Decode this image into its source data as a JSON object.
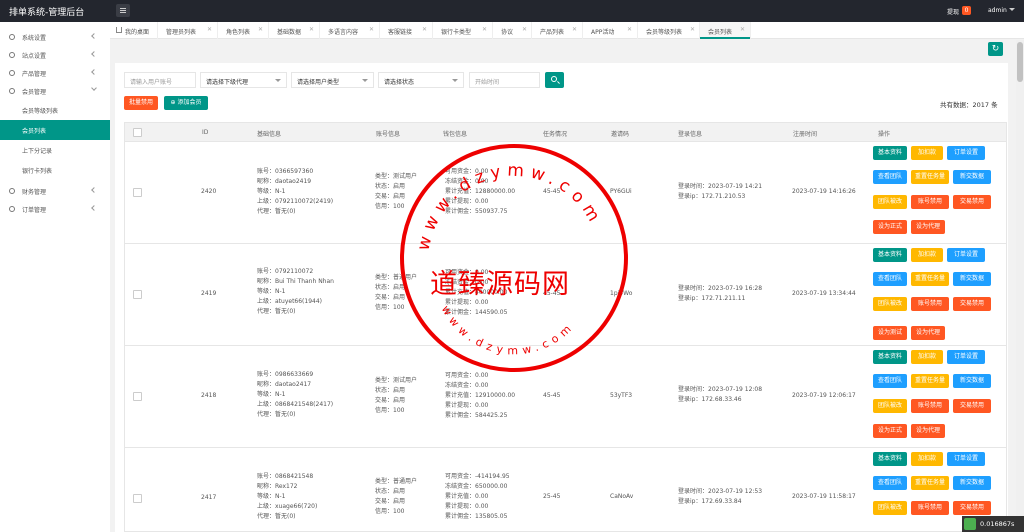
{
  "app": {
    "title": "排单系统-管理后台"
  },
  "header": {
    "notice_label": "提现",
    "notice_count": "0",
    "user": "admin"
  },
  "sidebar": {
    "items": [
      {
        "label": "系统设置"
      },
      {
        "label": "站点设置"
      },
      {
        "label": "产品管理"
      },
      {
        "label": "会员管理"
      },
      {
        "label": "财务管理"
      },
      {
        "label": "订单管理"
      }
    ],
    "member_sub": [
      {
        "label": "会员等级列表"
      },
      {
        "label": "会员列表"
      },
      {
        "label": "上下分记录"
      },
      {
        "label": "银行卡列表"
      }
    ]
  },
  "tabs": [
    {
      "label": "我的桌面"
    },
    {
      "label": "管理员列表"
    },
    {
      "label": "角色列表"
    },
    {
      "label": "基础数据"
    },
    {
      "label": "多语言内容"
    },
    {
      "label": "客服链接"
    },
    {
      "label": "银行卡类型"
    },
    {
      "label": "协议"
    },
    {
      "label": "产品列表"
    },
    {
      "label": "APP活动"
    },
    {
      "label": "会员等级列表"
    },
    {
      "label": "会员列表"
    }
  ],
  "filters": {
    "account_placeholder": "请输入用户账号",
    "agent": "请选择下级代理",
    "user_type": "请选择用户类型",
    "status": "请选择状态",
    "start_time": "开始时间"
  },
  "actions": {
    "batch_ban": "批量禁用",
    "add_member": "添加会员"
  },
  "total": "共有数据：2017 条",
  "columns": [
    "ID",
    "基础信息",
    "账号信息",
    "钱包信息",
    "任务情况",
    "邀请码",
    "登录信息",
    "注册时间",
    "操作"
  ],
  "rows": [
    {
      "id": "2420",
      "basic": [
        "账号：0366597360",
        "昵称：daotao2419",
        "等级：N-1",
        "上级：0792110072(2419)",
        "代理：暂无(0)"
      ],
      "account": [
        "类型：测试用户",
        "状态：启用",
        "交易：启用",
        "信用：100"
      ],
      "wallet": [
        "可用资金：0.00",
        "冻结资金：0.00",
        "累计充值：12880000.00",
        "累计提现：0.00",
        "累计佣金：550937.75"
      ],
      "task": "45-45",
      "invite": "PY6GUi",
      "login": [
        "登录时间：2023-07-19 14:21",
        "登录ip：172.71.210.53"
      ],
      "register": "2023-07-19 14:16:26",
      "ops": [
        [
          "基本资料",
          "加扣款",
          "订单设置"
        ],
        [
          "查看团队",
          "重置任务量",
          "新交数据"
        ],
        [
          "团队被改",
          "账号禁用",
          "交易禁用"
        ],
        [
          "设为正式",
          "设为代理"
        ]
      ]
    },
    {
      "id": "2419",
      "basic": [
        "账号：0792110072",
        "昵称：Bui Thi Thanh Nhan",
        "等级：N-1",
        "上级：atuyet66(1944)",
        "代理：暂无(0)"
      ],
      "account": [
        "类型：普通用户",
        "状态：启用",
        "交易：启用",
        "信用：100"
      ],
      "wallet": [
        "可用资金：0.00",
        "冻结资金：0.00",
        "累计充值：400000.00",
        "累计提现：0.00",
        "累计佣金：144590.05"
      ],
      "task": "45-45",
      "invite": "1pi4Wo",
      "login": [
        "登录时间：2023-07-19 16:28",
        "登录ip：172.71.211.11"
      ],
      "register": "2023-07-19 13:34:44",
      "ops": [
        [
          "基本资料",
          "加扣款",
          "订单设置"
        ],
        [
          "查看团队",
          "重置任务量",
          "新交数据"
        ],
        [
          "团队被改",
          "账号禁用",
          "交易禁用"
        ],
        [
          "设为测试",
          "设为代理"
        ]
      ]
    },
    {
      "id": "2418",
      "basic": [
        "账号：0986633669",
        "昵称：daotao2417",
        "等级：N-1",
        "上级：0868421548(2417)",
        "代理：暂无(0)"
      ],
      "account": [
        "类型：测试用户",
        "状态：启用",
        "交易：启用",
        "信用：100"
      ],
      "wallet": [
        "可用资金：0.00",
        "冻结资金：0.00",
        "累计充值：12910000.00",
        "累计提现：0.00",
        "累计佣金：584425.25"
      ],
      "task": "45-45",
      "invite": "53yTF3",
      "login": [
        "登录时间：2023-07-19 12:08",
        "登录ip：172.68.33.46"
      ],
      "register": "2023-07-19 12:06:17",
      "ops": [
        [
          "基本资料",
          "加扣款",
          "订单设置"
        ],
        [
          "查看团队",
          "重置任务量",
          "新交数据"
        ],
        [
          "团队被改",
          "账号禁用",
          "交易禁用"
        ],
        [
          "设为正式",
          "设为代理"
        ]
      ]
    },
    {
      "id": "2417",
      "basic": [
        "账号：0868421548",
        "昵称：Rex172",
        "等级：N-1",
        "上级：xuage66(720)",
        "代理：暂无(0)"
      ],
      "account": [
        "类型：普通用户",
        "状态：启用",
        "交易：启用",
        "信用：100"
      ],
      "wallet": [
        "可用资金：-414194.95",
        "冻结资金：650000.00",
        "累计充值：0.00",
        "累计提现：0.00",
        "累计佣金：135805.05"
      ],
      "task": "25-45",
      "invite": "CaNoAv",
      "login": [
        "登录时间：2023-07-19 12:53",
        "登录ip：172.69.33.84"
      ],
      "register": "2023-07-19 11:58:17",
      "ops": [
        [
          "基本资料",
          "加扣款",
          "订单设置"
        ],
        [
          "查看团队",
          "重置任务量",
          "新交数据"
        ],
        [
          "团队被改",
          "账号禁用",
          "交易禁用"
        ]
      ]
    }
  ],
  "watermark": {
    "main": "道臻源码网",
    "top_url": "www.dzymw.com",
    "bottom_url": "www.dzymw.com"
  },
  "perf": "0.016867s",
  "colors": {
    "primary": "#009688",
    "blue": "#1e9fff",
    "orange": "#ffb800",
    "red": "#ff5722",
    "topbar": "#23262e"
  }
}
